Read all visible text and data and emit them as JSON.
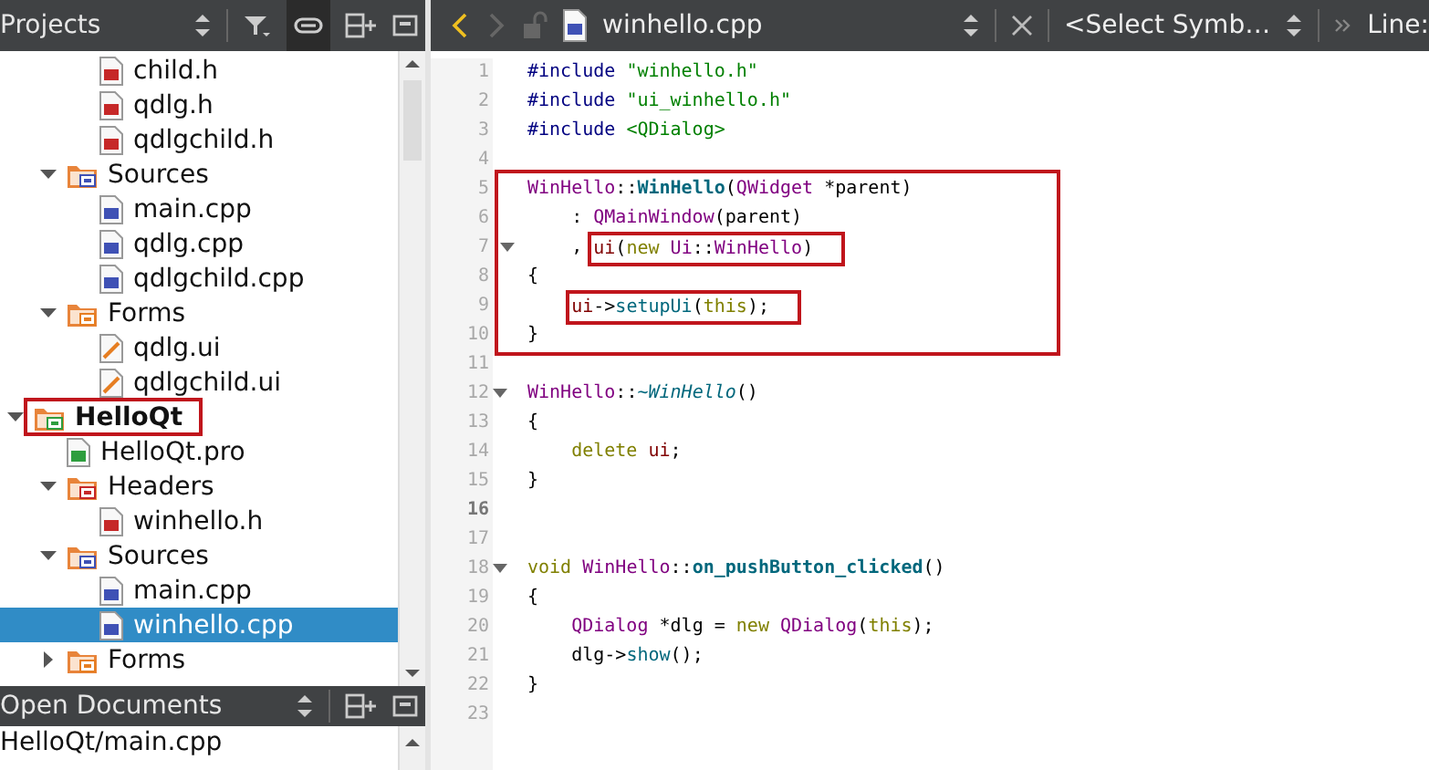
{
  "projects_panel": {
    "title": "Projects",
    "tree": [
      {
        "kind": "hidden",
        "children": [
          {
            "kind": "hidden",
            "children": [
              {
                "label": "child.h",
                "kind": "header",
                "selected": false
              },
              {
                "label": "qdlg.h",
                "kind": "header",
                "selected": false
              },
              {
                "label": "qdlgchild.h",
                "kind": "header",
                "selected": false
              }
            ]
          },
          {
            "label": "Sources",
            "kind": "sources",
            "expanded": true,
            "selected": false,
            "children": [
              {
                "label": "main.cpp",
                "kind": "source",
                "selected": false
              },
              {
                "label": "qdlg.cpp",
                "kind": "source",
                "selected": false
              },
              {
                "label": "qdlgchild.cpp",
                "kind": "source",
                "selected": false
              }
            ]
          },
          {
            "label": "Forms",
            "kind": "forms",
            "expanded": true,
            "selected": false,
            "children": [
              {
                "label": "qdlg.ui",
                "kind": "form",
                "selected": false
              },
              {
                "label": "qdlgchild.ui",
                "kind": "form",
                "selected": false
              }
            ]
          }
        ]
      },
      {
        "label": "HelloQt",
        "kind": "project",
        "expanded": true,
        "selected": false,
        "highlighted": true,
        "children": [
          {
            "label": "HelloQt.pro",
            "kind": "pro",
            "selected": false
          },
          {
            "label": "Headers",
            "kind": "headers",
            "expanded": true,
            "selected": false,
            "children": [
              {
                "label": "winhello.h",
                "kind": "header",
                "selected": false
              }
            ]
          },
          {
            "label": "Sources",
            "kind": "sources",
            "expanded": true,
            "selected": false,
            "children": [
              {
                "label": "main.cpp",
                "kind": "source",
                "selected": false
              },
              {
                "label": "winhello.cpp",
                "kind": "source",
                "selected": true
              }
            ]
          },
          {
            "label": "Forms",
            "kind": "forms",
            "expanded": false,
            "selected": false
          }
        ]
      }
    ]
  },
  "open_documents": {
    "title": "Open Documents",
    "items": [
      {
        "label": "HelloQt/main.cpp",
        "selected": false
      }
    ]
  },
  "editor_toolbar": {
    "back_enabled": true,
    "forward_enabled": false,
    "file_name": "winhello.cpp",
    "symbol": "<Select Symb…",
    "line_label": "Line:"
  },
  "editor": {
    "blocks": [
      {
        "lines": [
          {
            "n": "1",
            "current": false,
            "segs": [
              {
                "kind": "pre",
                "text": "#include "
              },
              {
                "kind": "str",
                "text": "\"winhello.h\""
              }
            ]
          },
          {
            "n": "2",
            "current": false,
            "segs": [
              {
                "kind": "pre",
                "text": "#include "
              },
              {
                "kind": "str",
                "text": "\"ui_winhello.h\""
              }
            ]
          },
          {
            "n": "3",
            "current": false,
            "segs": [
              {
                "kind": "pre",
                "text": "#include "
              },
              {
                "kind": "str",
                "text": "<QDialog>"
              }
            ]
          },
          {
            "n": "4",
            "current": false
          }
        ]
      },
      {
        "boxed": true,
        "lines": [
          {
            "n": "5",
            "current": false,
            "segs": [
              {
                "kind": "type",
                "text": "WinHello"
              },
              {
                "kind": "plain",
                "text": "::"
              },
              {
                "kind": "decl",
                "text": "WinHello"
              },
              {
                "kind": "plain",
                "text": "("
              },
              {
                "kind": "type",
                "text": "QWidget"
              },
              {
                "kind": "plain",
                "text": " *parent)"
              }
            ]
          },
          {
            "n": "6",
            "current": false,
            "indented": true,
            "segs": [
              {
                "kind": "plain",
                "text": ": "
              },
              {
                "kind": "type",
                "text": "QMainWindow"
              },
              {
                "kind": "plain",
                "text": "(parent)"
              }
            ]
          },
          {
            "n": "7",
            "fold": true,
            "current": false,
            "indented": true,
            "segs": [
              {
                "kind": "plain",
                "text": ", "
              },
              {
                "boxed": true,
                "parts": [
                  {
                    "kind": "member",
                    "text": "ui"
                  },
                  {
                    "kind": "plain",
                    "text": "("
                  },
                  {
                    "kind": "kw",
                    "text": "new "
                  },
                  {
                    "kind": "type",
                    "text": "Ui"
                  },
                  {
                    "kind": "plain",
                    "text": "::"
                  },
                  {
                    "kind": "type",
                    "text": "WinHello"
                  },
                  {
                    "kind": "plain",
                    "text": ")"
                  }
                ]
              }
            ]
          },
          {
            "n": "8",
            "current": false,
            "segs": [
              {
                "kind": "plain",
                "text": "{"
              }
            ]
          },
          {
            "n": "9",
            "current": false,
            "indented": true,
            "segs": [
              {
                "boxed": true,
                "parts": [
                  {
                    "kind": "member",
                    "text": "ui"
                  },
                  {
                    "kind": "plain",
                    "text": "->"
                  },
                  {
                    "kind": "fn",
                    "text": "setupUi"
                  },
                  {
                    "kind": "plain",
                    "text": "("
                  },
                  {
                    "kind": "kw",
                    "text": "this"
                  },
                  {
                    "kind": "plain",
                    "text": ");"
                  }
                ]
              }
            ]
          },
          {
            "n": "10",
            "current": false,
            "segs": [
              {
                "kind": "plain",
                "text": "}"
              }
            ]
          }
        ]
      },
      {
        "lines": [
          {
            "n": "11",
            "current": false
          },
          {
            "n": "12",
            "fold": true,
            "current": false,
            "segs": [
              {
                "kind": "type",
                "text": "WinHello"
              },
              {
                "kind": "plain",
                "text": "::"
              },
              {
                "kind": "virt",
                "text": "~WinHello"
              },
              {
                "kind": "plain",
                "text": "()"
              }
            ]
          },
          {
            "n": "13",
            "current": false,
            "segs": [
              {
                "kind": "plain",
                "text": "{"
              }
            ]
          },
          {
            "n": "14",
            "current": false,
            "indented": true,
            "segs": [
              {
                "kind": "kw",
                "text": "delete "
              },
              {
                "kind": "member",
                "text": "ui"
              },
              {
                "kind": "plain",
                "text": ";"
              }
            ]
          },
          {
            "n": "15",
            "current": false,
            "segs": [
              {
                "kind": "plain",
                "text": "}"
              }
            ]
          },
          {
            "n": "16",
            "current": true
          },
          {
            "n": "17",
            "current": false
          },
          {
            "n": "18",
            "fold": true,
            "current": false,
            "segs": [
              {
                "kind": "kw",
                "text": "void "
              },
              {
                "kind": "type",
                "text": "WinHello"
              },
              {
                "kind": "plain",
                "text": "::"
              },
              {
                "kind": "decl",
                "text": "on_pushButton_clicked"
              },
              {
                "kind": "plain",
                "text": "()"
              }
            ]
          },
          {
            "n": "19",
            "current": false,
            "segs": [
              {
                "kind": "plain",
                "text": "{"
              }
            ]
          },
          {
            "n": "20",
            "current": false,
            "indented": true,
            "segs": [
              {
                "kind": "type",
                "text": "QDialog"
              },
              {
                "kind": "plain",
                "text": " *dlg = "
              },
              {
                "kind": "kw",
                "text": "new "
              },
              {
                "kind": "type",
                "text": "QDialog"
              },
              {
                "kind": "plain",
                "text": "("
              },
              {
                "kind": "kw",
                "text": "this"
              },
              {
                "kind": "plain",
                "text": ");"
              }
            ]
          },
          {
            "n": "21",
            "current": false,
            "indented": true,
            "segs": [
              {
                "kind": "plain",
                "text": "dlg->"
              },
              {
                "kind": "fn",
                "text": "show"
              },
              {
                "kind": "plain",
                "text": "();"
              }
            ]
          },
          {
            "n": "22",
            "current": false,
            "segs": [
              {
                "kind": "plain",
                "text": "}"
              }
            ]
          },
          {
            "n": "23",
            "current": false
          }
        ]
      }
    ]
  }
}
